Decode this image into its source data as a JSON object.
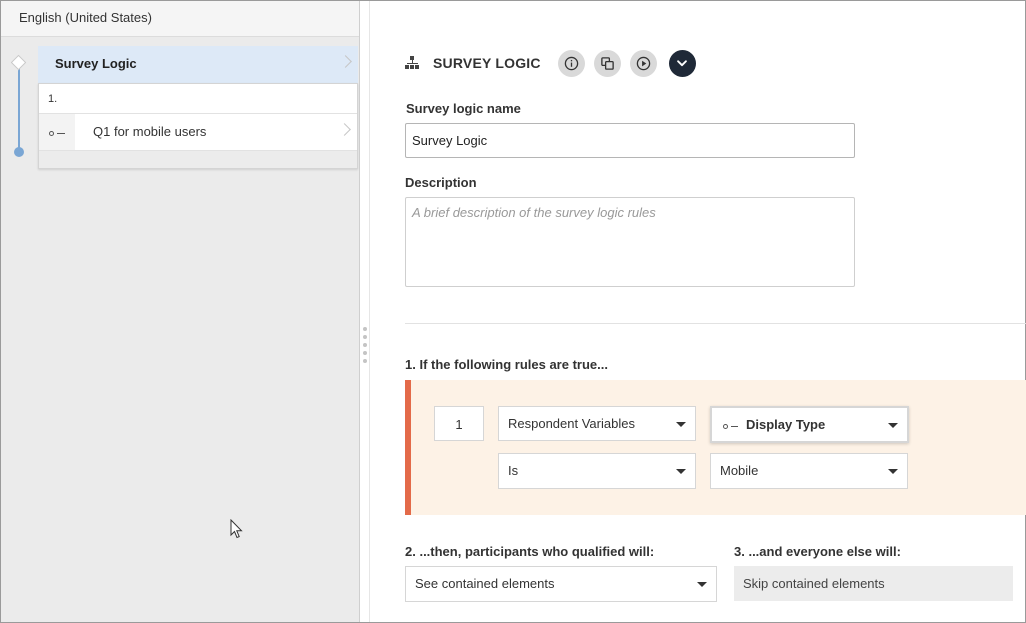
{
  "left": {
    "language": "English (United States)",
    "logic_title": "Survey Logic",
    "card_number": "1.",
    "question_label": "Q1 for mobile users"
  },
  "header": {
    "title": "SURVEY LOGIC",
    "icons": [
      "sitemap-icon",
      "info-icon",
      "copy-icon",
      "play-icon",
      "chevron-down-icon"
    ]
  },
  "form": {
    "name_label": "Survey logic name",
    "name_value": "Survey Logic",
    "description_label": "Description",
    "description_placeholder": "A brief description of the survey logic rules"
  },
  "rules": {
    "section_label": "1. If the following rules are true...",
    "rule_number": "1",
    "source": "Respondent Variables",
    "variable": "Display Type",
    "operator": "Is",
    "value": "Mobile",
    "accent_color": "#e36a49"
  },
  "actions": {
    "qualified_label": "2. ...then, participants who qualified will:",
    "qualified_value": "See contained elements",
    "others_label": "3. ...and everyone else will:",
    "others_value": "Skip contained elements"
  }
}
